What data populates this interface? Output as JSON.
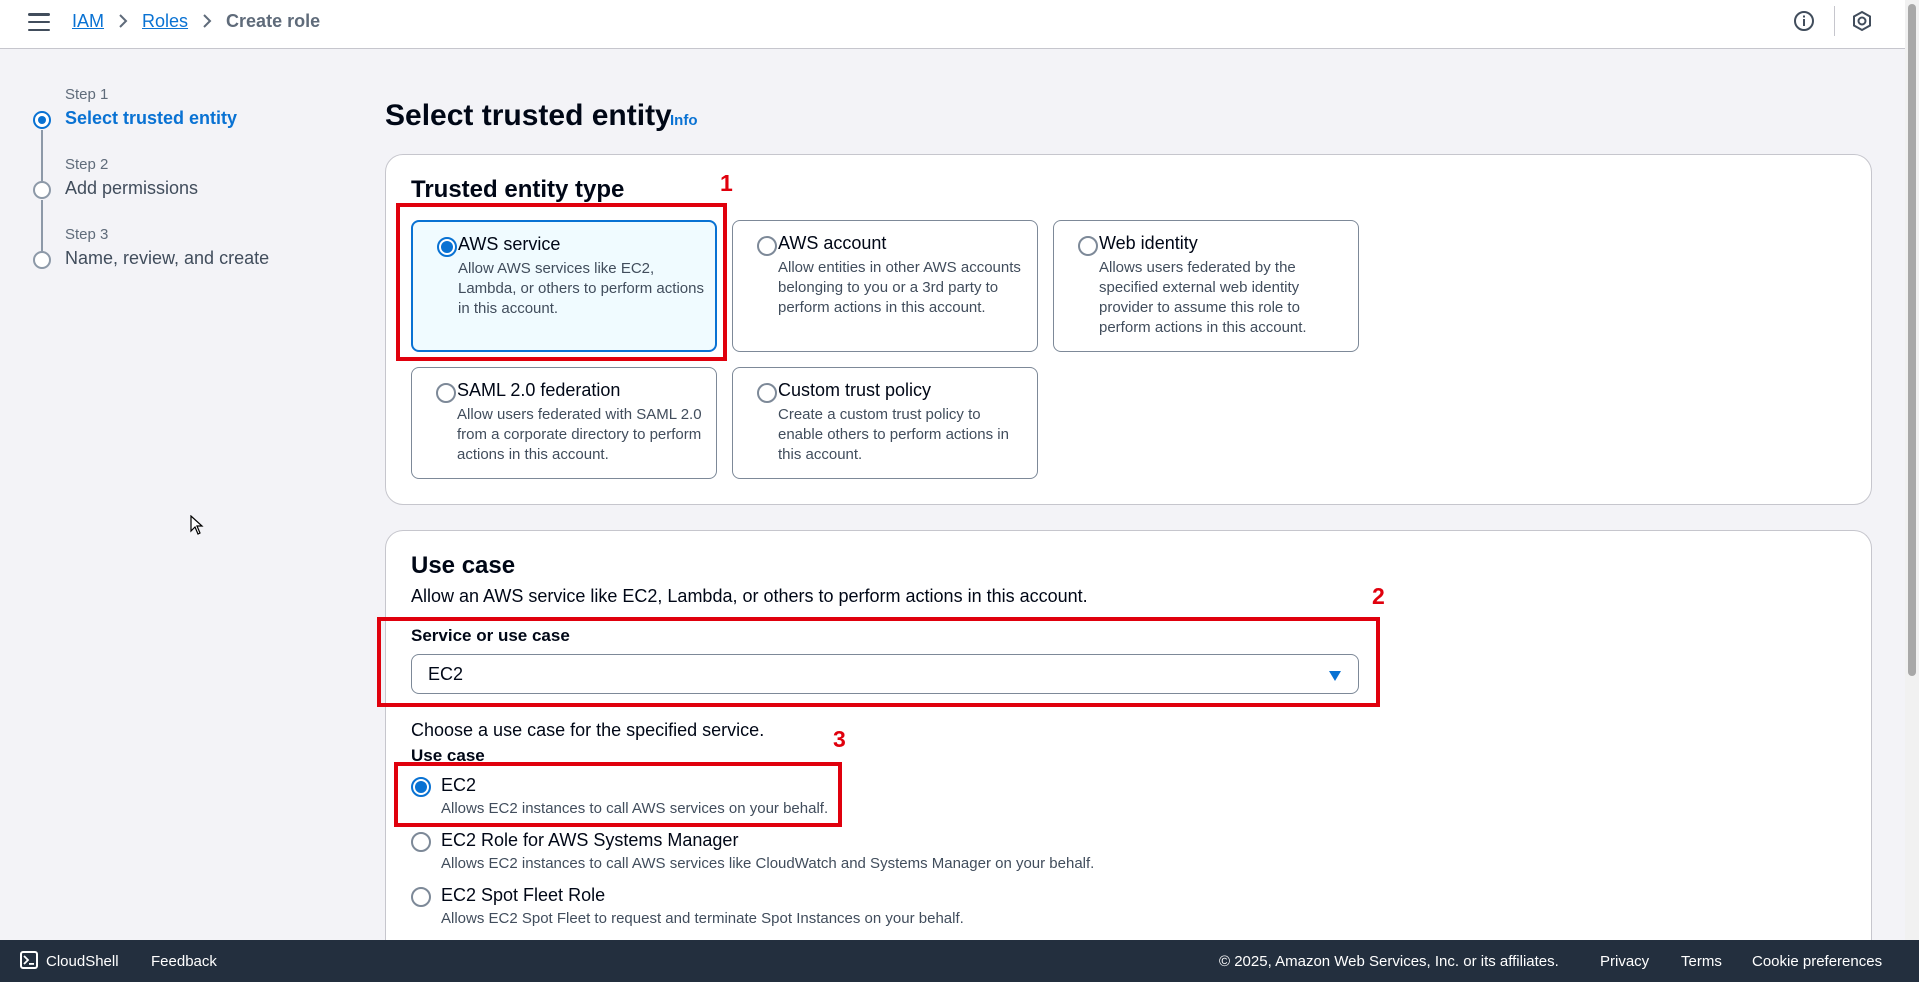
{
  "breadcrumb": {
    "items": [
      "IAM",
      "Roles"
    ],
    "current": "Create role"
  },
  "top_icons": [
    "info-circle-icon",
    "settings-hexagon-icon"
  ],
  "steps": [
    {
      "label": "Step 1",
      "title": "Select trusted entity",
      "state": "active"
    },
    {
      "label": "Step 2",
      "title": "Add permissions",
      "state": "pending"
    },
    {
      "label": "Step 3",
      "title": "Name, review, and create",
      "state": "pending"
    }
  ],
  "page": {
    "title": "Select trusted entity",
    "info": "Info"
  },
  "trusted_entity": {
    "heading": "Trusted entity type",
    "selected": "AWS service",
    "options": [
      {
        "title": "AWS service",
        "desc": "Allow AWS services like EC2, Lambda, or others to perform actions in this account."
      },
      {
        "title": "AWS account",
        "desc": "Allow entities in other AWS accounts belonging to you or a 3rd party to perform actions in this account."
      },
      {
        "title": "Web identity",
        "desc": "Allows users federated by the specified external web identity provider to assume this role to perform actions in this account."
      },
      {
        "title": "SAML 2.0 federation",
        "desc": "Allow users federated with SAML 2.0 from a corporate directory to perform actions in this account."
      },
      {
        "title": "Custom trust policy",
        "desc": "Create a custom trust policy to enable others to perform actions in this account."
      }
    ]
  },
  "use_case_section": {
    "heading": "Use case",
    "description": "Allow an AWS service like EC2, Lambda, or others to perform actions in this account.",
    "service_label": "Service or use case",
    "service_value": "EC2",
    "choose_text": "Choose a use case for the specified service.",
    "use_case_label": "Use case",
    "selected": "EC2",
    "options": [
      {
        "title": "EC2",
        "desc": "Allows EC2 instances to call AWS services on your behalf."
      },
      {
        "title": "EC2 Role for AWS Systems Manager",
        "desc": "Allows EC2 instances to call AWS services like CloudWatch and Systems Manager on your behalf."
      },
      {
        "title": "EC2 Spot Fleet Role",
        "desc": "Allows EC2 Spot Fleet to request and terminate Spot Instances on your behalf."
      }
    ]
  },
  "annotations": [
    "1",
    "2",
    "3"
  ],
  "footer": {
    "cloudshell": "CloudShell",
    "feedback": "Feedback",
    "copyright": "© 2025, Amazon Web Services, Inc. or its affiliates.",
    "privacy": "Privacy",
    "terms": "Terms",
    "cookies": "Cookie preferences"
  },
  "colors": {
    "accent": "#0972d3",
    "annotation": "#e0000d",
    "footer_bg": "#232f3e",
    "page_bg": "#f3f3f7"
  }
}
